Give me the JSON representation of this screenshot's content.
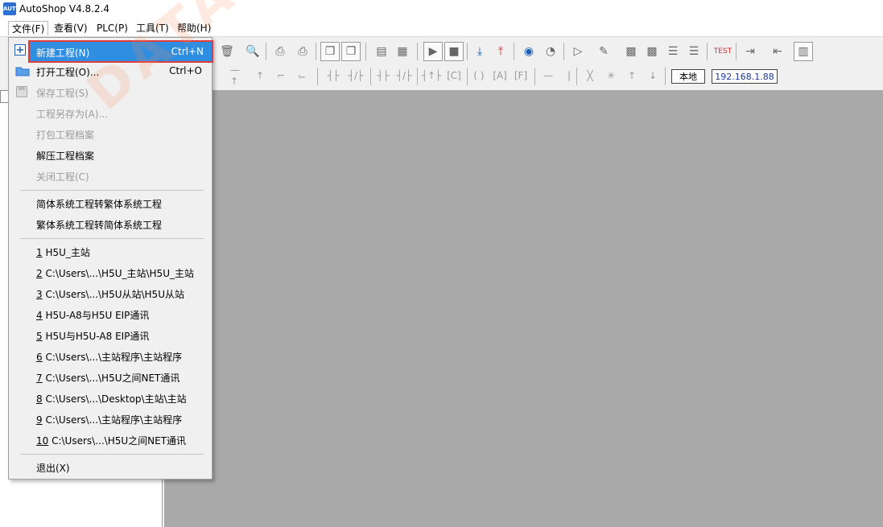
{
  "window": {
    "title": "AutoShop V4.8.2.4",
    "app_icon_text": "AUTO"
  },
  "menubar": [
    {
      "label": "文件(F)"
    },
    {
      "label": "查看(V)"
    },
    {
      "label": "PLC(P)"
    },
    {
      "label": "工具(T)"
    },
    {
      "label": "帮助(H)"
    }
  ],
  "file_menu": {
    "new_project": {
      "label": "新建工程(N)",
      "shortcut": "Ctrl+N"
    },
    "open_project": {
      "label": "打开工程(O)...",
      "shortcut": "Ctrl+O"
    },
    "save_project": {
      "label": "保存工程(S)"
    },
    "save_as": {
      "label": "工程另存为(A)..."
    },
    "pack_archive": {
      "label": "打包工程档案"
    },
    "unpack_archive": {
      "label": "解压工程档案"
    },
    "close_project": {
      "label": "关闭工程(C)"
    },
    "simp_to_trad": {
      "label": "简体系统工程转繁体系统工程"
    },
    "trad_to_simp": {
      "label": "繁体系统工程转简体系统工程"
    },
    "recent": [
      {
        "num": "1",
        "path": " H5U_主站"
      },
      {
        "num": "2",
        "path": " C:\\Users\\...\\H5U_主站\\H5U_主站"
      },
      {
        "num": "3",
        "path": " C:\\Users\\...\\H5U从站\\H5U从站"
      },
      {
        "num": "4",
        "path": " H5U-A8与H5U EIP通讯"
      },
      {
        "num": "5",
        "path": " H5U与H5U-A8 EIP通讯"
      },
      {
        "num": "6",
        "path": " C:\\Users\\...\\主站程序\\主站程序"
      },
      {
        "num": "7",
        "path": " C:\\Users\\...\\H5U之间NET通讯"
      },
      {
        "num": "8",
        "path": " C:\\Users\\...\\Desktop\\主站\\主站"
      },
      {
        "num": "9",
        "path": " C:\\Users\\...\\主站程序\\主站程序"
      },
      {
        "num": "10",
        "path": " C:\\Users\\...\\H5U之间NET通讯"
      }
    ],
    "exit": {
      "label": "退出(X)"
    }
  },
  "toolbar2": {
    "mode_label": "本地",
    "ip_address": "192.168.1.88"
  },
  "watermark": "DATAE"
}
